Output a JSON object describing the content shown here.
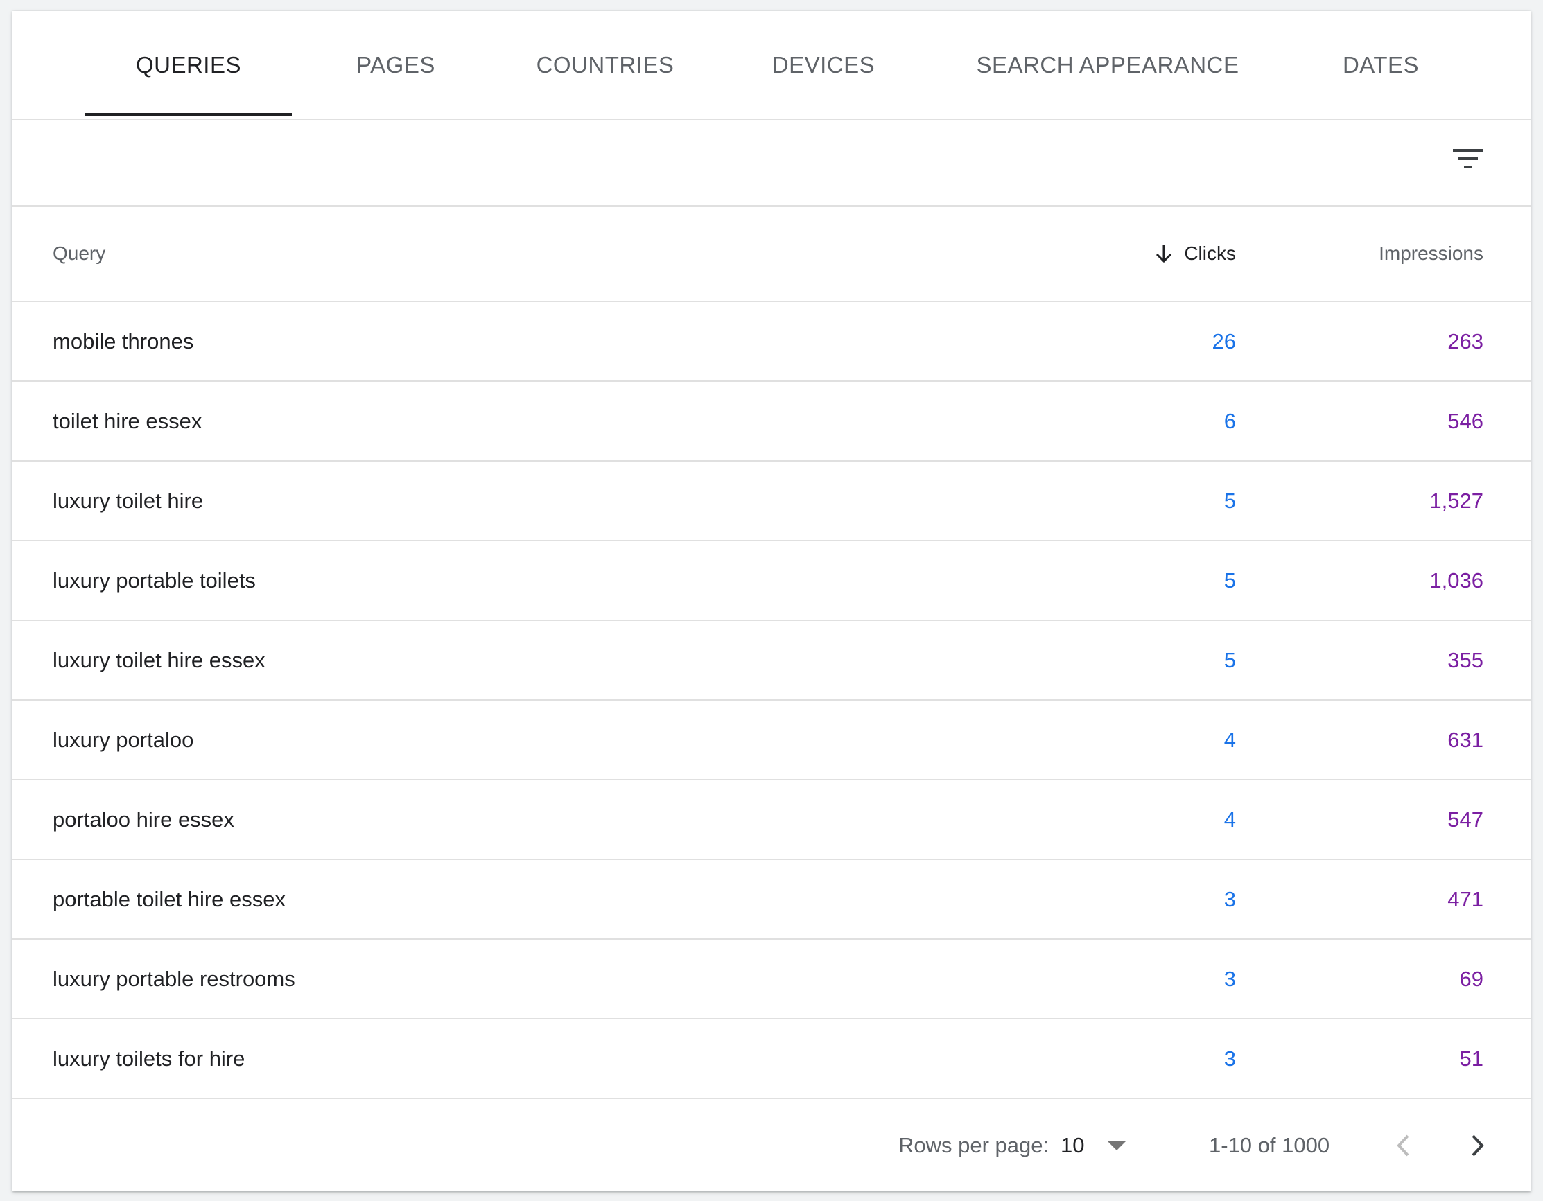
{
  "tabs": [
    {
      "label": "QUERIES",
      "active": true
    },
    {
      "label": "PAGES",
      "active": false
    },
    {
      "label": "COUNTRIES",
      "active": false
    },
    {
      "label": "DEVICES",
      "active": false
    },
    {
      "label": "SEARCH APPEARANCE",
      "active": false
    },
    {
      "label": "DATES",
      "active": false
    }
  ],
  "filter": {
    "icon": "filter-list-icon"
  },
  "table": {
    "headers": {
      "query": "Query",
      "clicks": "Clicks",
      "impressions": "Impressions"
    },
    "sort": {
      "column": "clicks",
      "direction": "descending",
      "icon": "arrow-down-icon"
    },
    "rows": [
      {
        "query": "mobile thrones",
        "clicks": "26",
        "impressions": "263"
      },
      {
        "query": "toilet hire essex",
        "clicks": "6",
        "impressions": "546"
      },
      {
        "query": "luxury toilet hire",
        "clicks": "5",
        "impressions": "1,527"
      },
      {
        "query": "luxury portable toilets",
        "clicks": "5",
        "impressions": "1,036"
      },
      {
        "query": "luxury toilet hire essex",
        "clicks": "5",
        "impressions": "355"
      },
      {
        "query": "luxury portaloo",
        "clicks": "4",
        "impressions": "631"
      },
      {
        "query": "portaloo hire essex",
        "clicks": "4",
        "impressions": "547"
      },
      {
        "query": "portable toilet hire essex",
        "clicks": "3",
        "impressions": "471"
      },
      {
        "query": "luxury portable restrooms",
        "clicks": "3",
        "impressions": "69"
      },
      {
        "query": "luxury toilets for hire",
        "clicks": "3",
        "impressions": "51"
      }
    ]
  },
  "pagination": {
    "rows_per_page_label": "Rows per page:",
    "rows_per_page_value": "10",
    "range": "1-10 of 1000",
    "prev_icon": "chevron-left-icon",
    "next_icon": "chevron-right-icon",
    "prev_enabled": false,
    "next_enabled": true
  },
  "colors": {
    "clicks": "#1a73e8",
    "impressions": "#7b1fa2",
    "active_tab": "#202124",
    "inactive_tab": "#5f6368",
    "divider": "#e0e0e0"
  }
}
